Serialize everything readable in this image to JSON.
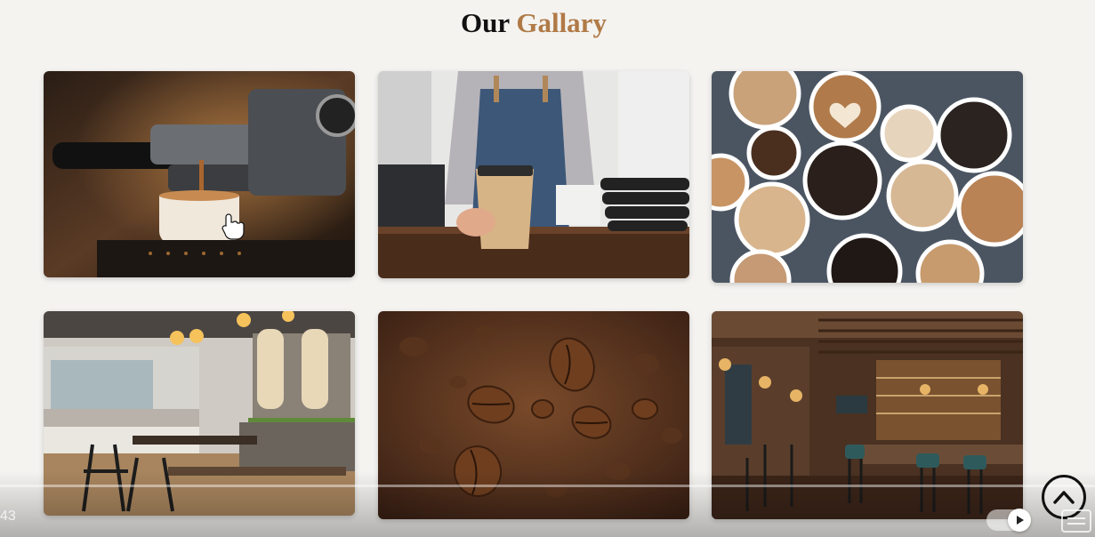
{
  "heading": {
    "prefix": "Our",
    "accent": "Gallary"
  },
  "gallery": {
    "images": [
      {
        "subject": "espresso-machine-pouring"
      },
      {
        "subject": "barista-holding-paper-cup"
      },
      {
        "subject": "assorted-coffee-cups-top-view"
      },
      {
        "subject": "cafe-interior-seating"
      },
      {
        "subject": "falling-coffee-beans"
      },
      {
        "subject": "bar-interior-with-stools"
      }
    ]
  },
  "player": {
    "time": "43"
  },
  "colors": {
    "accent": "#b07a47",
    "background": "#f4f3f0"
  },
  "icons": {
    "scroll_top": "chevron-up-icon",
    "play": "play-icon",
    "captions": "captions-icon",
    "cursor": "hand-cursor-icon"
  }
}
